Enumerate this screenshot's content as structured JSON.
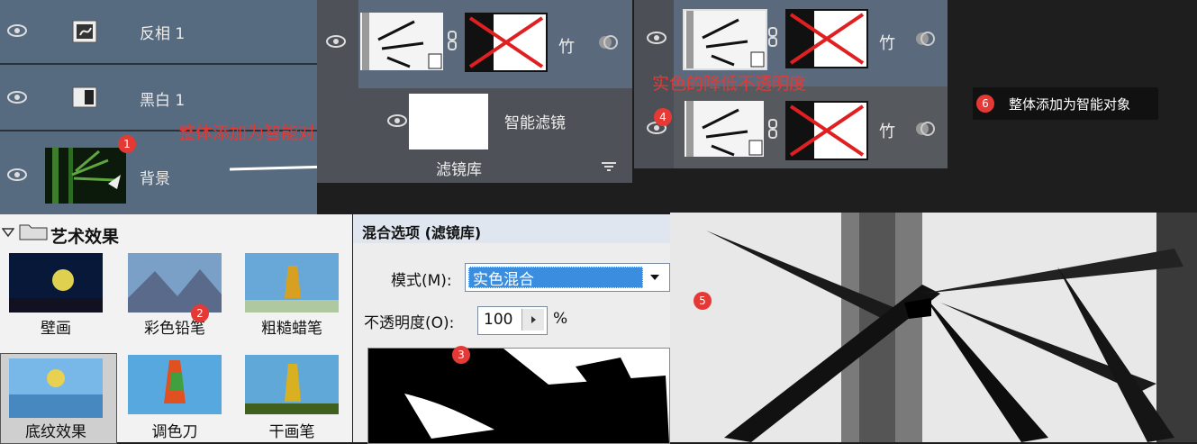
{
  "layers_panel": {
    "rows": [
      {
        "label": "反相 1",
        "icon": "invert-adjustment-icon"
      },
      {
        "label": "黑白 1",
        "icon": "black-white-adjustment-icon"
      },
      {
        "label": "背景",
        "icon": "bamboo-thumbnail"
      }
    ]
  },
  "annotation_smart_object": "整体添加为智能对象",
  "smart_filter_panel": {
    "layer_name": "竹",
    "smart_filter_label": "智能滤镜",
    "filter_gallery_label": "滤镜库"
  },
  "right_panel": {
    "annotation_opacity": "实色的降低不透明度",
    "layer_name_1": "竹",
    "layer_name_2": "竹"
  },
  "tooltip": {
    "badge": "6",
    "text": "整体添加为智能对象"
  },
  "art_effects": {
    "header": "艺术效果",
    "items": [
      "壁画",
      "彩色铅笔",
      "粗糙蜡笔",
      "底纹效果",
      "调色刀",
      "干画笔"
    ]
  },
  "blend_dialog": {
    "title": "混合选项 (滤镜库)",
    "mode_label": "模式(M):",
    "mode_value": "实色混合",
    "opacity_label": "不透明度(O):",
    "opacity_value": "100",
    "percent": "%"
  },
  "badges": [
    "1",
    "2",
    "3",
    "4",
    "5"
  ]
}
